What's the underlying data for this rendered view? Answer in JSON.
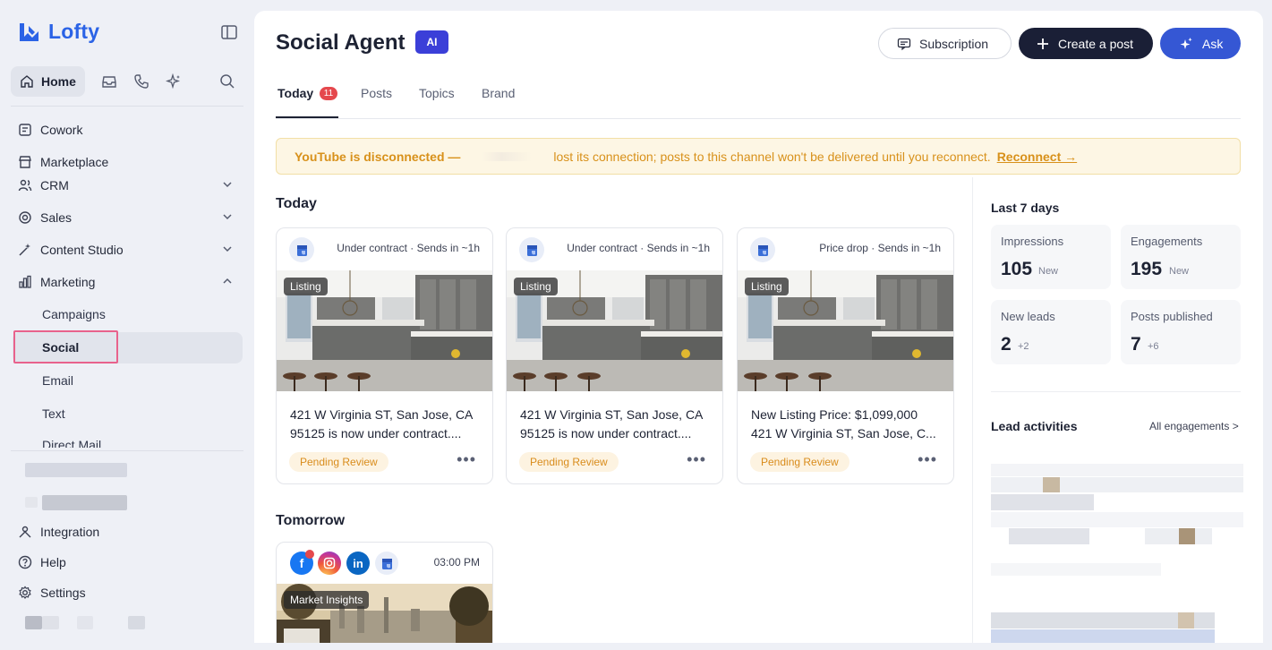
{
  "app": {
    "name": "Lofty"
  },
  "sidebar": {
    "home_label": "Home",
    "items": [
      {
        "label": "Cowork"
      },
      {
        "label": "Marketplace"
      },
      {
        "label": "CRM"
      },
      {
        "label": "Sales"
      },
      {
        "label": "Content Studio"
      },
      {
        "label": "Marketing"
      }
    ],
    "marketing_sub": [
      "Campaigns",
      "Social",
      "Email",
      "Text",
      "Direct Mail"
    ],
    "bottom": [
      "Integration",
      "Help",
      "Settings"
    ]
  },
  "header": {
    "title": "Social Agent",
    "ai_badge": "AI",
    "subscription_label": "Subscription",
    "create_label": "Create a post",
    "ask_label": "Ask"
  },
  "tabs": [
    {
      "label": "Today",
      "count": "11"
    },
    {
      "label": "Posts"
    },
    {
      "label": "Topics"
    },
    {
      "label": "Brand"
    }
  ],
  "alert": {
    "title": "YouTube is disconnected —",
    "message": "lost its connection; posts to this channel won't be delivered until you reconnect.",
    "link": "Reconnect →"
  },
  "sections": {
    "today": "Today",
    "tomorrow": "Tomorrow"
  },
  "cards": [
    {
      "status": "Under contract · Sends in ~1h",
      "tag": "Listing",
      "line1": "421 W Virginia ST, San Jose, CA",
      "line2": "95125 is now under contract....",
      "badge": "Pending Review"
    },
    {
      "status": "Under contract · Sends in ~1h",
      "tag": "Listing",
      "line1": "421 W Virginia ST, San Jose, CA",
      "line2": "95125 is now under contract....",
      "badge": "Pending Review"
    },
    {
      "status": "Price drop · Sends in ~1h",
      "tag": "Listing",
      "line1": "New Listing Price: $1,099,000",
      "line2": "421 W Virginia ST, San Jose, C...",
      "badge": "Pending Review"
    }
  ],
  "tomorrow_card": {
    "time": "03:00 PM",
    "tag": "Market Insights",
    "icons": [
      "facebook-icon",
      "instagram-icon",
      "linkedin-icon",
      "google-business-icon"
    ]
  },
  "stats": {
    "title": "Last 7 days",
    "items": [
      {
        "label": "Impressions",
        "value": "105",
        "delta": "New"
      },
      {
        "label": "Engagements",
        "value": "195",
        "delta": "New"
      },
      {
        "label": "New leads",
        "value": "2",
        "delta": "+2"
      },
      {
        "label": "Posts published",
        "value": "7",
        "delta": "+6"
      }
    ]
  },
  "leads": {
    "title": "Lead activities",
    "link": "All engagements >"
  },
  "colors": {
    "brand": "#2b63e6",
    "ai_badge": "#3b3fd8",
    "ask_button": "#3557d4",
    "create_button": "#1a1f36",
    "highlight_box": "#e8628c",
    "alert_text": "#d8911b"
  }
}
